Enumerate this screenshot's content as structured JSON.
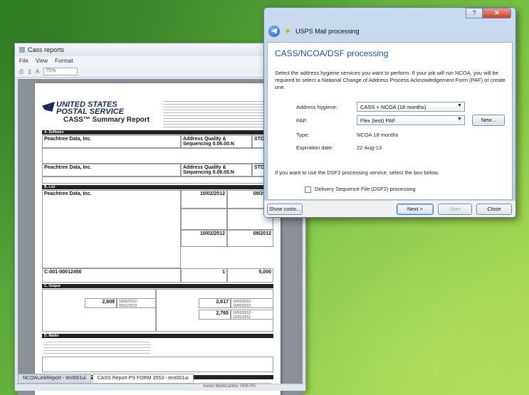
{
  "back_window": {
    "title": "Cass reports",
    "menu": [
      "File",
      "View",
      "Format"
    ],
    "zoom": "75%",
    "tabs": [
      "NCOALinkReport - test001ui",
      "CASS Report PS FORM 3553 - test001ui"
    ],
    "status": "Xerox WorkCentre 7435 PS"
  },
  "report": {
    "logo_line1": "UNITED STATES",
    "logo_line2": "POSTAL SERVICE",
    "title": "CASS™ Summary Report",
    "section_software": "A. Software",
    "company_1": "Peachtree Data, Inc.",
    "software_1": "Address Quality & Sequencing 0.06.00.N",
    "config_1": "STD",
    "company_2": "Peachtree Data, Inc.",
    "software_2": "Address Quality & Sequencing 0.06.00.N",
    "config_2": "STD",
    "section_list": "B. List",
    "processor": "Peachtree Data, Inc.",
    "date_master": "10/02/2012",
    "date_db": "09/2012",
    "date_2": "10/02/2012",
    "date_3": "09/2012",
    "list_id": "C-001-00012450",
    "num_lists": "1",
    "total_records": "5,000",
    "section_output": "C. Output",
    "out_zip": "2,609",
    "out_zip_dates": "10/02/2012 - 03/31/2013",
    "out_5digit": "2,617",
    "out_5digit_dates": "10/02/2012 - 10/02/2013",
    "out_crrt": "2,765",
    "out_crrt_dates": "10/02/2012 - 12/31/2012",
    "section_mailer": "D. Mailer",
    "section_qss": "E. Qualitative Statistical Summary (QSS)"
  },
  "dialog": {
    "title": "USPS Mail processing",
    "controls": {
      "help": "?",
      "close": "✕"
    },
    "heading": "CASS/NCOA/DSF processing",
    "description": "Select the address hygiene services you want to perform. If your job will run NCOA, you will be required to select a National Change of Address Process Acknowledgement Form (PAF) or create one.",
    "address_hygiene_label": "Address hygiene:",
    "address_hygiene_value": "CASS + NCOA (18 months)",
    "paf_label": "PAF:",
    "paf_value": "Flex (test) PAF",
    "new_button": "New...",
    "type_label": "Type:",
    "type_value": "NCOA 18 months",
    "expiration_label": "Expiration date:",
    "expiration_value": "22-Aug-13",
    "dsf2_note": "If you want to use the DSF2 processing service, select the box below.",
    "dsf2_checkbox": "Delivery Sequence File (DSF2) processing",
    "show_costs": "Show costs...",
    "next": "Next >",
    "start": "Start",
    "close": "Close"
  }
}
